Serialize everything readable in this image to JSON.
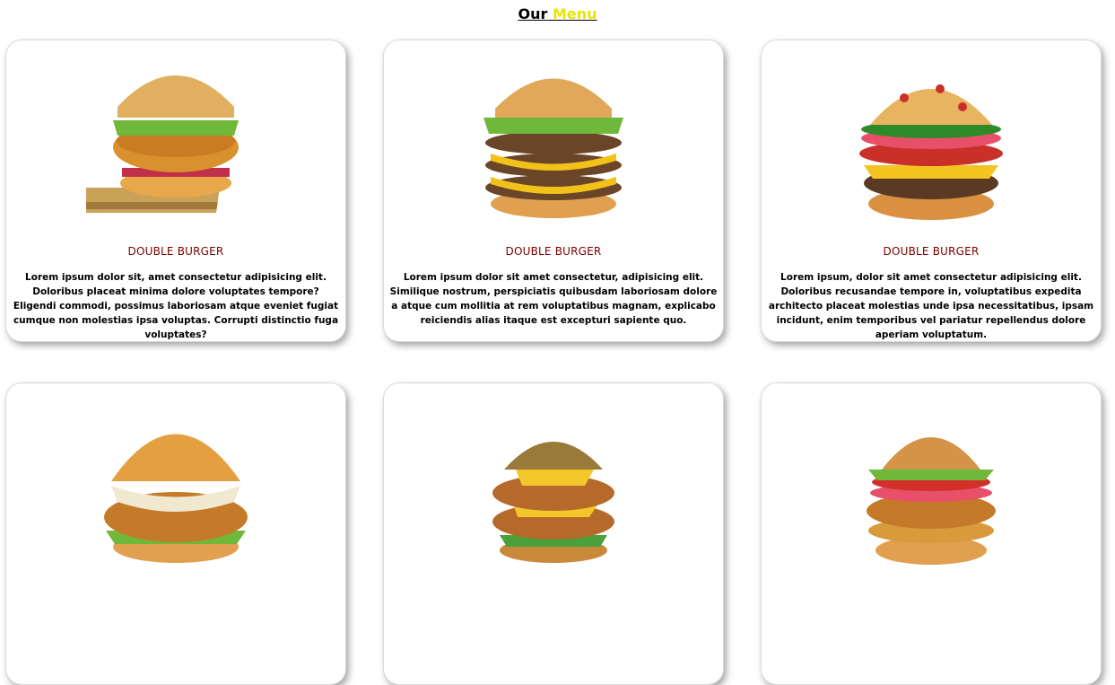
{
  "header": {
    "word1": "Our",
    "word2": "Menu"
  },
  "cards": [
    {
      "title": "DOUBLE BURGER",
      "desc": "Lorem ipsum dolor sit, amet consectetur adipisicing elit. Doloribus placeat minima dolore voluptates tempore? Eligendi commodi, possimus laboriosam atque eveniet fugiat cumque non molestias ipsa voluptas. Corrupti distinctio fuga voluptates?"
    },
    {
      "title": "DOUBLE BURGER",
      "desc": "Lorem ipsum dolor sit amet consectetur, adipisicing elit. Similique nostrum, perspiciatis quibusdam laboriosam dolore a atque cum mollitia at rem voluptatibus magnam, explicabo reiciendis alias itaque est excepturi sapiente quo."
    },
    {
      "title": "DOUBLE BURGER",
      "desc": "Lorem ipsum, dolor sit amet consectetur adipisicing elit. Doloribus recusandae tempore in, voluptatibus expedita architecto placeat molestias unde ipsa necessitatibus, ipsam incidunt, enim temporibus vel pariatur repellendus dolore aperiam voluptatum."
    },
    {
      "title": "",
      "desc": ""
    },
    {
      "title": "",
      "desc": ""
    },
    {
      "title": "",
      "desc": ""
    }
  ],
  "colors": {
    "accent": "#e6e600",
    "title": "#7a0000"
  }
}
